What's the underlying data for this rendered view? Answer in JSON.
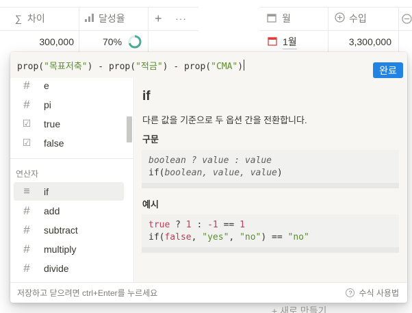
{
  "table_left": {
    "col_diff": {
      "icon": "sum-icon",
      "label": "차이"
    },
    "col_rate": {
      "icon": "bars-icon",
      "label": "달성율"
    },
    "add": "+",
    "more": "···",
    "row1": {
      "diff": "300,000",
      "rate": "70%",
      "progress": 0.7
    }
  },
  "table_right": {
    "col_month": {
      "icon": "calendar-icon",
      "label": "월"
    },
    "col_income": {
      "icon": "plus-circle-icon",
      "label": "수입"
    },
    "row1": {
      "month": "1월",
      "income": "3,300,000"
    },
    "new_row": "+ 새로 만들기"
  },
  "formula": {
    "tokens": [
      {
        "t": "prop(",
        "k": "fn"
      },
      {
        "t": "\"목표저축\"",
        "k": "str"
      },
      {
        "t": ")",
        "k": "fn"
      },
      {
        "t": " - ",
        "k": "op"
      },
      {
        "t": "prop(",
        "k": "fn"
      },
      {
        "t": "\"적금\"",
        "k": "str"
      },
      {
        "t": ")",
        "k": "fn"
      },
      {
        "t": " - ",
        "k": "op"
      },
      {
        "t": "prop(",
        "k": "fn"
      },
      {
        "t": "\"CMA\"",
        "k": "str"
      },
      {
        "t": ")",
        "k": "fn"
      }
    ],
    "done_label": "완료"
  },
  "list": {
    "top_items": [
      {
        "icon": "hash-icon",
        "label": "e"
      },
      {
        "icon": "hash-icon",
        "label": "pi"
      },
      {
        "icon": "checkbox-icon",
        "label": "true"
      },
      {
        "icon": "checkbox-icon",
        "label": "false"
      }
    ],
    "section_label": "연산자",
    "operator_items": [
      {
        "icon": "lines-icon",
        "label": "if",
        "selected": true
      },
      {
        "icon": "hash-icon",
        "label": "add"
      },
      {
        "icon": "hash-icon",
        "label": "subtract"
      },
      {
        "icon": "hash-icon",
        "label": "multiply"
      },
      {
        "icon": "hash-icon",
        "label": "divide"
      }
    ]
  },
  "doc": {
    "title": "if",
    "description": "다른 값을 기준으로 두 옵션 간을 전환합니다.",
    "syntax_heading": "구문",
    "syntax_line1": "boolean ? value : value",
    "syntax_line2_prefix": "if(",
    "syntax_line2_args": "boolean, value, value",
    "syntax_line2_suffix": ")",
    "example_heading": "예시",
    "example_line1": {
      "a": "true",
      "b": " ? ",
      "c": "1",
      "d": " : ",
      "e": "-1",
      "f": " == ",
      "g": "1"
    },
    "example_line2": {
      "a": "if(",
      "b": "false",
      "c": ", ",
      "d": "\"yes\"",
      "e": ", ",
      "f": "\"no\"",
      "g": ") == ",
      "h": "\"no\""
    }
  },
  "footer": {
    "hint": "저장하고 닫으려면 ctrl+Enter를 누르세요",
    "help_label": "수식 사용법"
  },
  "colors": {
    "accent": "#2383e2",
    "string": "#5c8d2f",
    "keyword": "#b3425a",
    "calendar": "#e03e3e",
    "progress": "#4dab9a"
  }
}
